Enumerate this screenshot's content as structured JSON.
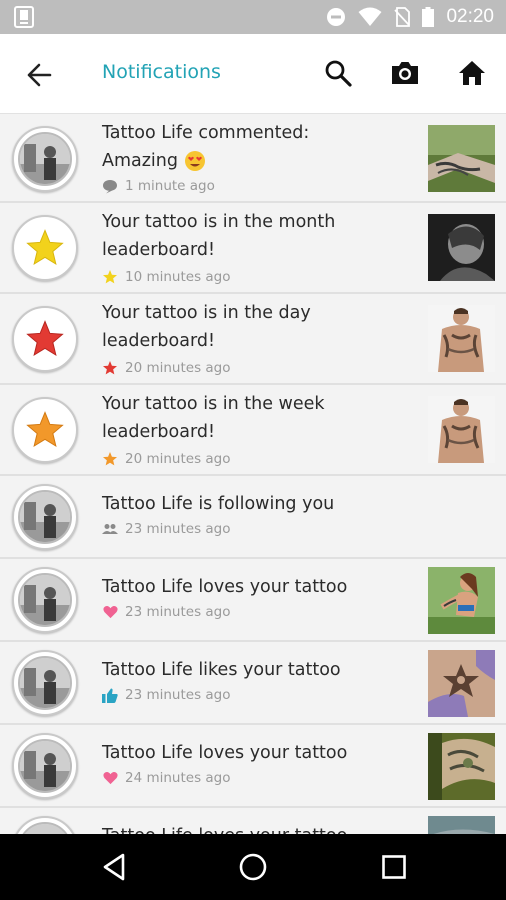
{
  "status_bar": {
    "time": "02:20",
    "icons": [
      "notification-icon",
      "dnd-icon",
      "wifi-icon",
      "no-sim-icon",
      "battery-icon"
    ]
  },
  "app_bar": {
    "title": "Notifications",
    "icons": [
      "back-arrow-icon",
      "search-icon",
      "camera-icon",
      "home-icon"
    ],
    "accent_color": "#22a3b5"
  },
  "notifications": [
    {
      "text": "Tattoo Life commented:",
      "text2": "Amazing",
      "emoji": "smiling-face-with-heart-eyes-icon",
      "meta_icon": "comment-icon",
      "time": "1 minute ago",
      "avatar": "profile-photo",
      "thumb": "tattoo-arm-sleeve"
    },
    {
      "text": "Your tattoo is in the month leaderboard!",
      "meta_icon": "yellow-star-icon",
      "time": "10 minutes ago",
      "avatar": "yellow-star",
      "thumb": "tattoo-dark-portrait"
    },
    {
      "text": "Your tattoo is in the day leaderboard!",
      "meta_icon": "red-star-icon",
      "time": "20 minutes ago",
      "avatar": "red-star",
      "thumb": "tattooed-man"
    },
    {
      "text": "Your tattoo is in the week leaderboard!",
      "meta_icon": "orange-star-icon",
      "time": "20 minutes ago",
      "avatar": "orange-star",
      "thumb": "tattooed-man"
    },
    {
      "text": "Tattoo Life is following you",
      "meta_icon": "people-icon",
      "time": "23 minutes ago",
      "avatar": "profile-photo",
      "thumb": ""
    },
    {
      "text": "Tattoo Life loves your tattoo",
      "meta_icon": "heart-icon",
      "time": "23 minutes ago",
      "avatar": "profile-photo",
      "thumb": "tattooed-woman"
    },
    {
      "text": "Tattoo Life likes your tattoo",
      "meta_icon": "thumbs-up-icon",
      "time": "23 minutes ago",
      "avatar": "profile-photo",
      "thumb": "tattoo-star-hand"
    },
    {
      "text": "Tattoo Life loves your tattoo",
      "meta_icon": "heart-icon",
      "time": "24 minutes ago",
      "avatar": "profile-photo",
      "thumb": "tattoo-green-arm"
    },
    {
      "text": "Tattoo Life loves your tattoo",
      "meta_icon": "heart-icon",
      "time": "",
      "avatar": "profile-photo",
      "thumb": "tattoo-partial"
    }
  ],
  "nav_bar": {
    "icons": [
      "back-triangle-icon",
      "home-circle-icon",
      "recents-square-icon"
    ]
  },
  "colors": {
    "star_yellow": "#f2d21c",
    "star_red": "#e23a33",
    "star_orange": "#f2982a",
    "heart_pink": "#f06292",
    "thumb_blue": "#2aa4c4"
  }
}
